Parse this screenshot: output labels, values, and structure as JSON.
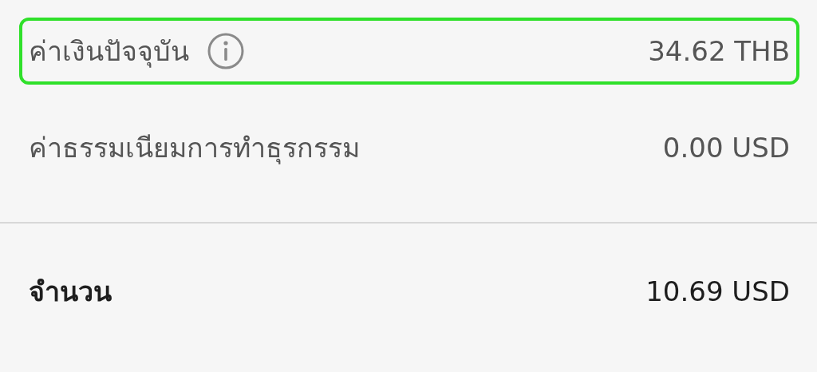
{
  "rows": [
    {
      "label": "ค่าเงินปัจจุบัน",
      "info": true,
      "value": "34.62 THB",
      "highlighted": true
    },
    {
      "label": "ค่าธรรมเนียมการทำธุรกรรม",
      "info": false,
      "value": "0.00 USD",
      "highlighted": false
    }
  ],
  "total": {
    "label": "จำนวน",
    "value": "10.69 USD"
  }
}
